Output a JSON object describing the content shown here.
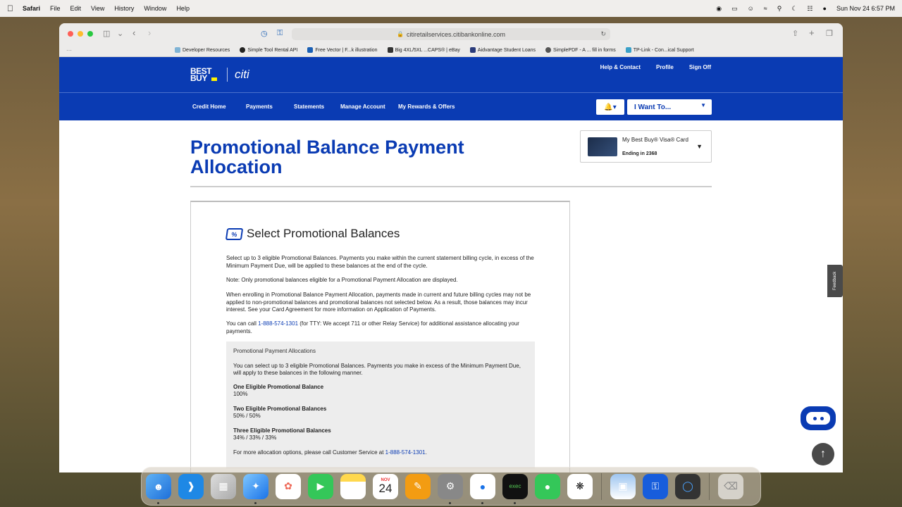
{
  "menubar": {
    "app": "Safari",
    "items": [
      "File",
      "Edit",
      "View",
      "History",
      "Window",
      "Help"
    ],
    "clock": "Sun Nov 24  6:57 PM"
  },
  "browser": {
    "url": "citiretailservices.citibankonline.com",
    "bookmarks": [
      "Developer Resources",
      "Simple Tool Rental API",
      "Free Vector | F...k illustration",
      "Big 4XL/5XL ...CAPS® | eBay",
      "Aidvantage Student Loans",
      "SimplePDF - A ... fill in forms",
      "TP-Link - Con...ical Support"
    ]
  },
  "header": {
    "brand": "BEST BUY",
    "partner": "citi",
    "toplinks": [
      "Help & Contact",
      "Profile",
      "Sign Off"
    ],
    "nav": [
      "Credit Home",
      "Payments",
      "Statements",
      "Manage Account",
      "My Rewards & Offers"
    ],
    "i_want": "I Want To..."
  },
  "page": {
    "title": "Promotional Balance Payment Allocation",
    "card": {
      "name": "My Best Buy® Visa® Card",
      "ending": "Ending in 2368"
    },
    "section_title": "Select Promotional Balances",
    "para1": "Select up to 3 eligible Promotional Balances. Payments you make within the current statement billing cycle, in excess of the Minimum Payment Due, will be applied to these balances at the end of the cycle.",
    "para2": "Note: Only promotional balances eligible for a Promotional Payment Allocation are displayed.",
    "para3": "When enrolling in Promotional Balance Payment Allocation, payments made in current and future billing cycles may not be applied to non-promotional balances and promotional balances not selected below. As a result, those balances may incur interest. See your Card Agreement for more information on Application of Payments.",
    "para4_pre": "You can call ",
    "phone": "1-888-574-1301",
    "para4_post": " (for TTY: We accept 711 or other Relay Service) for additional assistance allocating your payments.",
    "alloc": {
      "heading": "Promotional Payment Allocations",
      "intro": "You can select up to 3 eligible Promotional Balances. Payments you make in excess of the Minimum Payment Due, will apply to these balances in the following manner.",
      "one_label": "One Eligible Promotional Balance",
      "one_value": "100%",
      "two_label": "Two Eligible Promotional Balances",
      "two_value": "50% / 50%",
      "three_label": "Three Eligible Promotional Balances",
      "three_value": "34% / 33% / 33%",
      "footer_pre": "For more allocation options, please call Customer Service at ",
      "footer_phone": "1-888-574-1301",
      "footer_post": "."
    },
    "feedback": "Feedback"
  },
  "dock": {
    "calendar_month": "NOV",
    "calendar_day": "24"
  },
  "colors": {
    "brand_blue": "#0a3bb3",
    "bestbuy_yellow": "#fff200"
  }
}
